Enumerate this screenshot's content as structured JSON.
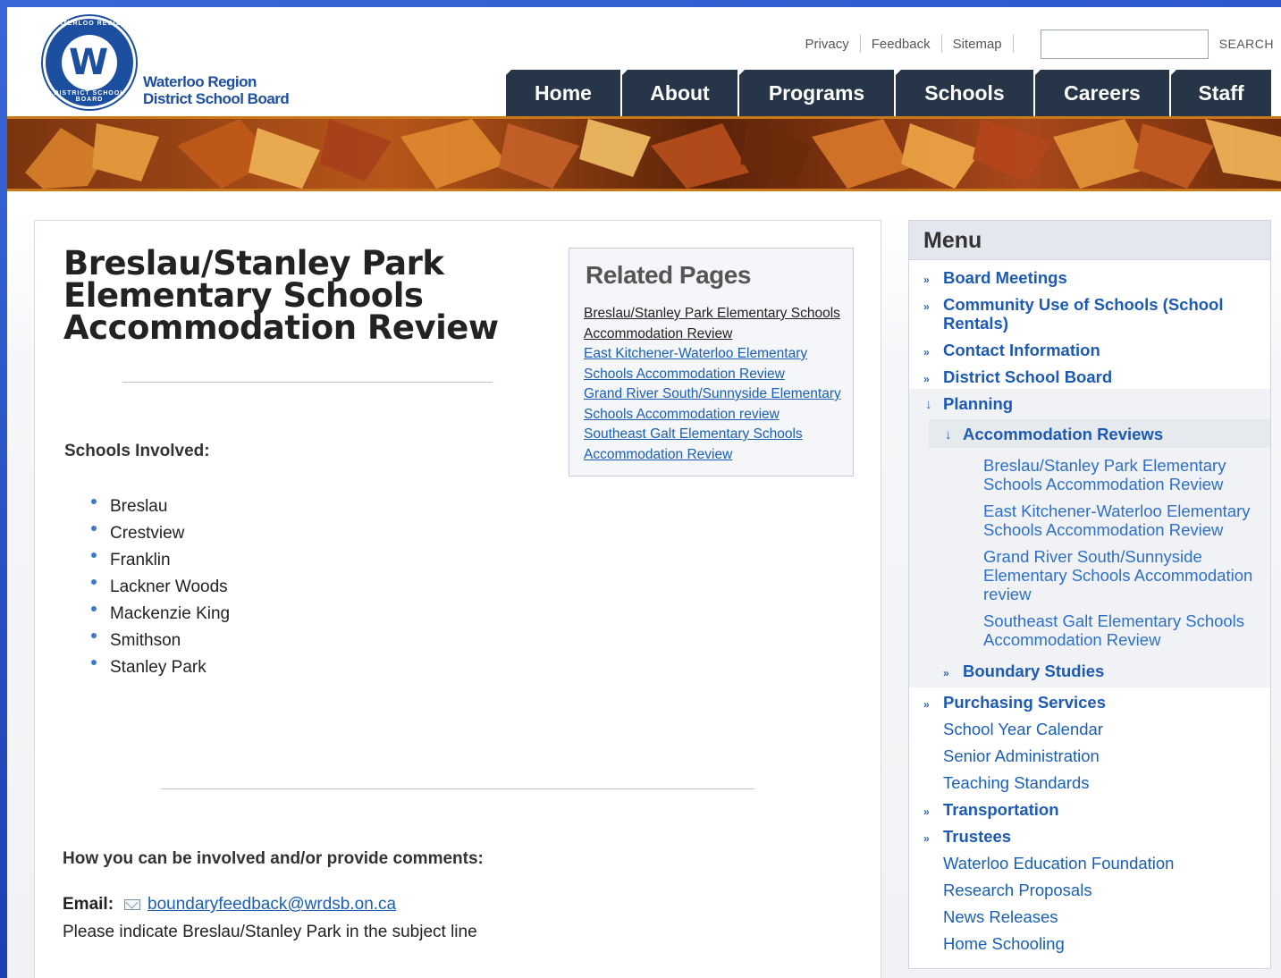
{
  "header": {
    "logo_text_line1": "Waterloo Region",
    "logo_text_line2": "District School Board",
    "logo_ring_top": "WATERLOO REGION",
    "logo_ring_bottom": "DISTRICT SCHOOL BOARD",
    "utility_links": [
      "Privacy",
      "Feedback",
      "Sitemap"
    ],
    "search_placeholder": "",
    "search_label": "SEARCH"
  },
  "nav": {
    "tabs": [
      "Home",
      "About",
      "Programs",
      "Schools",
      "Careers",
      "Staff"
    ]
  },
  "main": {
    "title": "Breslau/Stanley Park Elementary Schools Accommodation Review",
    "schools_label": "Schools Involved:",
    "schools": [
      "Breslau",
      "Crestview",
      "Franklin",
      "Lackner Woods",
      "Mackenzie King",
      "Smithson",
      "Stanley Park"
    ],
    "involve_heading": "How you can be involved and/or provide comments:",
    "email_label": "Email:",
    "email_address": "boundaryfeedback@wrdsb.on.ca",
    "subject_note": "Please indicate Breslau/Stanley Park in the subject line"
  },
  "related": {
    "heading": "Related Pages",
    "links": [
      "Breslau/Stanley Park Elementary Schools Accommodation Review",
      "East Kitchener-Waterloo Elementary Schools Accommodation Review",
      "Grand River South/Sunnyside Elementary Schools Accommodation review",
      "Southeast Galt Elementary Schools Accommodation Review"
    ]
  },
  "menu": {
    "heading": "Menu",
    "items": [
      "Board Meetings",
      "Community Use of Schools (School Rentals)",
      "Contact Information",
      "District School Board",
      "Planning",
      "Accommodation Reviews",
      "Breslau/Stanley Park Elementary Schools Accommodation Review",
      "East Kitchener-Waterloo Elementary Schools Accommodation Review",
      "Grand River South/Sunnyside Elementary Schools Accommodation review",
      "Southeast Galt Elementary Schools Accommodation Review",
      "Boundary Studies",
      "Purchasing Services",
      "School Year Calendar",
      "Senior Administration",
      "Teaching Standards",
      "Transportation",
      "Trustees",
      "Waterloo Education Foundation",
      "Research Proposals",
      "News Releases",
      "Home Schooling"
    ]
  },
  "colors": {
    "nav_bg": "#273549",
    "link": "#1a5fb4",
    "banner_border": "#c9781b"
  },
  "icons": {
    "menu_arrow": "double-chevron-right-icon",
    "menu_expanded": "down-arrow-icon",
    "email": "envelope-icon"
  }
}
